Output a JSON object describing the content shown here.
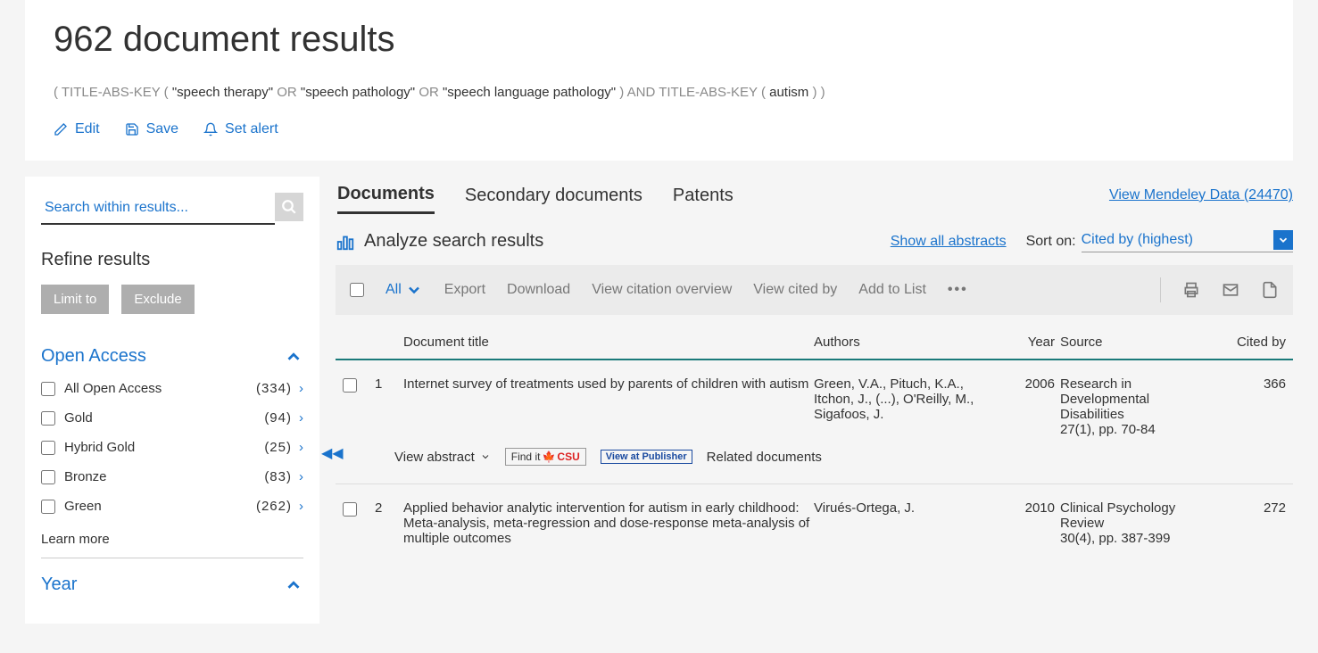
{
  "header": {
    "title": "962 document results",
    "query_parts": {
      "p1": "( TITLE-ABS-KEY (",
      "k1": "\"speech therapy\"",
      "or1": " OR ",
      "k2": "\"speech pathology\"",
      "or2": " OR ",
      "k3": "\"speech language pathology\"",
      "p2": ")  AND  TITLE-ABS-KEY (",
      "k4": "autism",
      "p3": ") )"
    },
    "actions": {
      "edit": "Edit",
      "save": "Save",
      "alert": "Set alert"
    }
  },
  "sidebar": {
    "search_placeholder": "Search within results...",
    "refine_title": "Refine results",
    "limit_label": "Limit to",
    "exclude_label": "Exclude",
    "facets": {
      "open_access": {
        "title": "Open Access",
        "items": [
          {
            "label": "All Open Access",
            "count": "(334)"
          },
          {
            "label": "Gold",
            "count": "(94)"
          },
          {
            "label": "Hybrid Gold",
            "count": "(25)"
          },
          {
            "label": "Bronze",
            "count": "(83)"
          },
          {
            "label": "Green",
            "count": "(262)"
          }
        ],
        "learn_more": "Learn more"
      },
      "year": {
        "title": "Year"
      }
    }
  },
  "content": {
    "tabs": {
      "documents": "Documents",
      "secondary": "Secondary documents",
      "patents": "Patents"
    },
    "mendeley": "View Mendeley Data (24470)",
    "analyze": "Analyze search results",
    "show_abstracts": "Show all abstracts",
    "sort_label": "Sort on:",
    "sort_value": "Cited by (highest)",
    "toolbar": {
      "all": "All",
      "export": "Export",
      "download": "Download",
      "citation": "View citation overview",
      "cited_by": "View cited by",
      "add_list": "Add to List"
    },
    "columns": {
      "title": "Document title",
      "authors": "Authors",
      "year": "Year",
      "source": "Source",
      "cited": "Cited by"
    },
    "rows": [
      {
        "num": "1",
        "title": "Internet survey of treatments used by parents of children with autism",
        "authors": "Green, V.A., Pituch, K.A., Itchon, J., (...), O'Reilly, M., Sigafoos, J.",
        "year": "2006",
        "source": "Research in Developmental Disabilities\n27(1), pp. 70-84",
        "cited": "366"
      },
      {
        "num": "2",
        "title": "Applied behavior analytic intervention for autism in early childhood: Meta-analysis, meta-regression and dose-response meta-analysis of multiple outcomes",
        "authors": "Virués-Ortega, J.",
        "year": "2010",
        "source": "Clinical Psychology Review\n30(4), pp. 387-399",
        "cited": "272"
      }
    ],
    "doc_links": {
      "view_abstract": "View abstract",
      "find": "Find it",
      "csu": "CSU",
      "publisher": "View at Publisher",
      "related": "Related documents"
    }
  }
}
